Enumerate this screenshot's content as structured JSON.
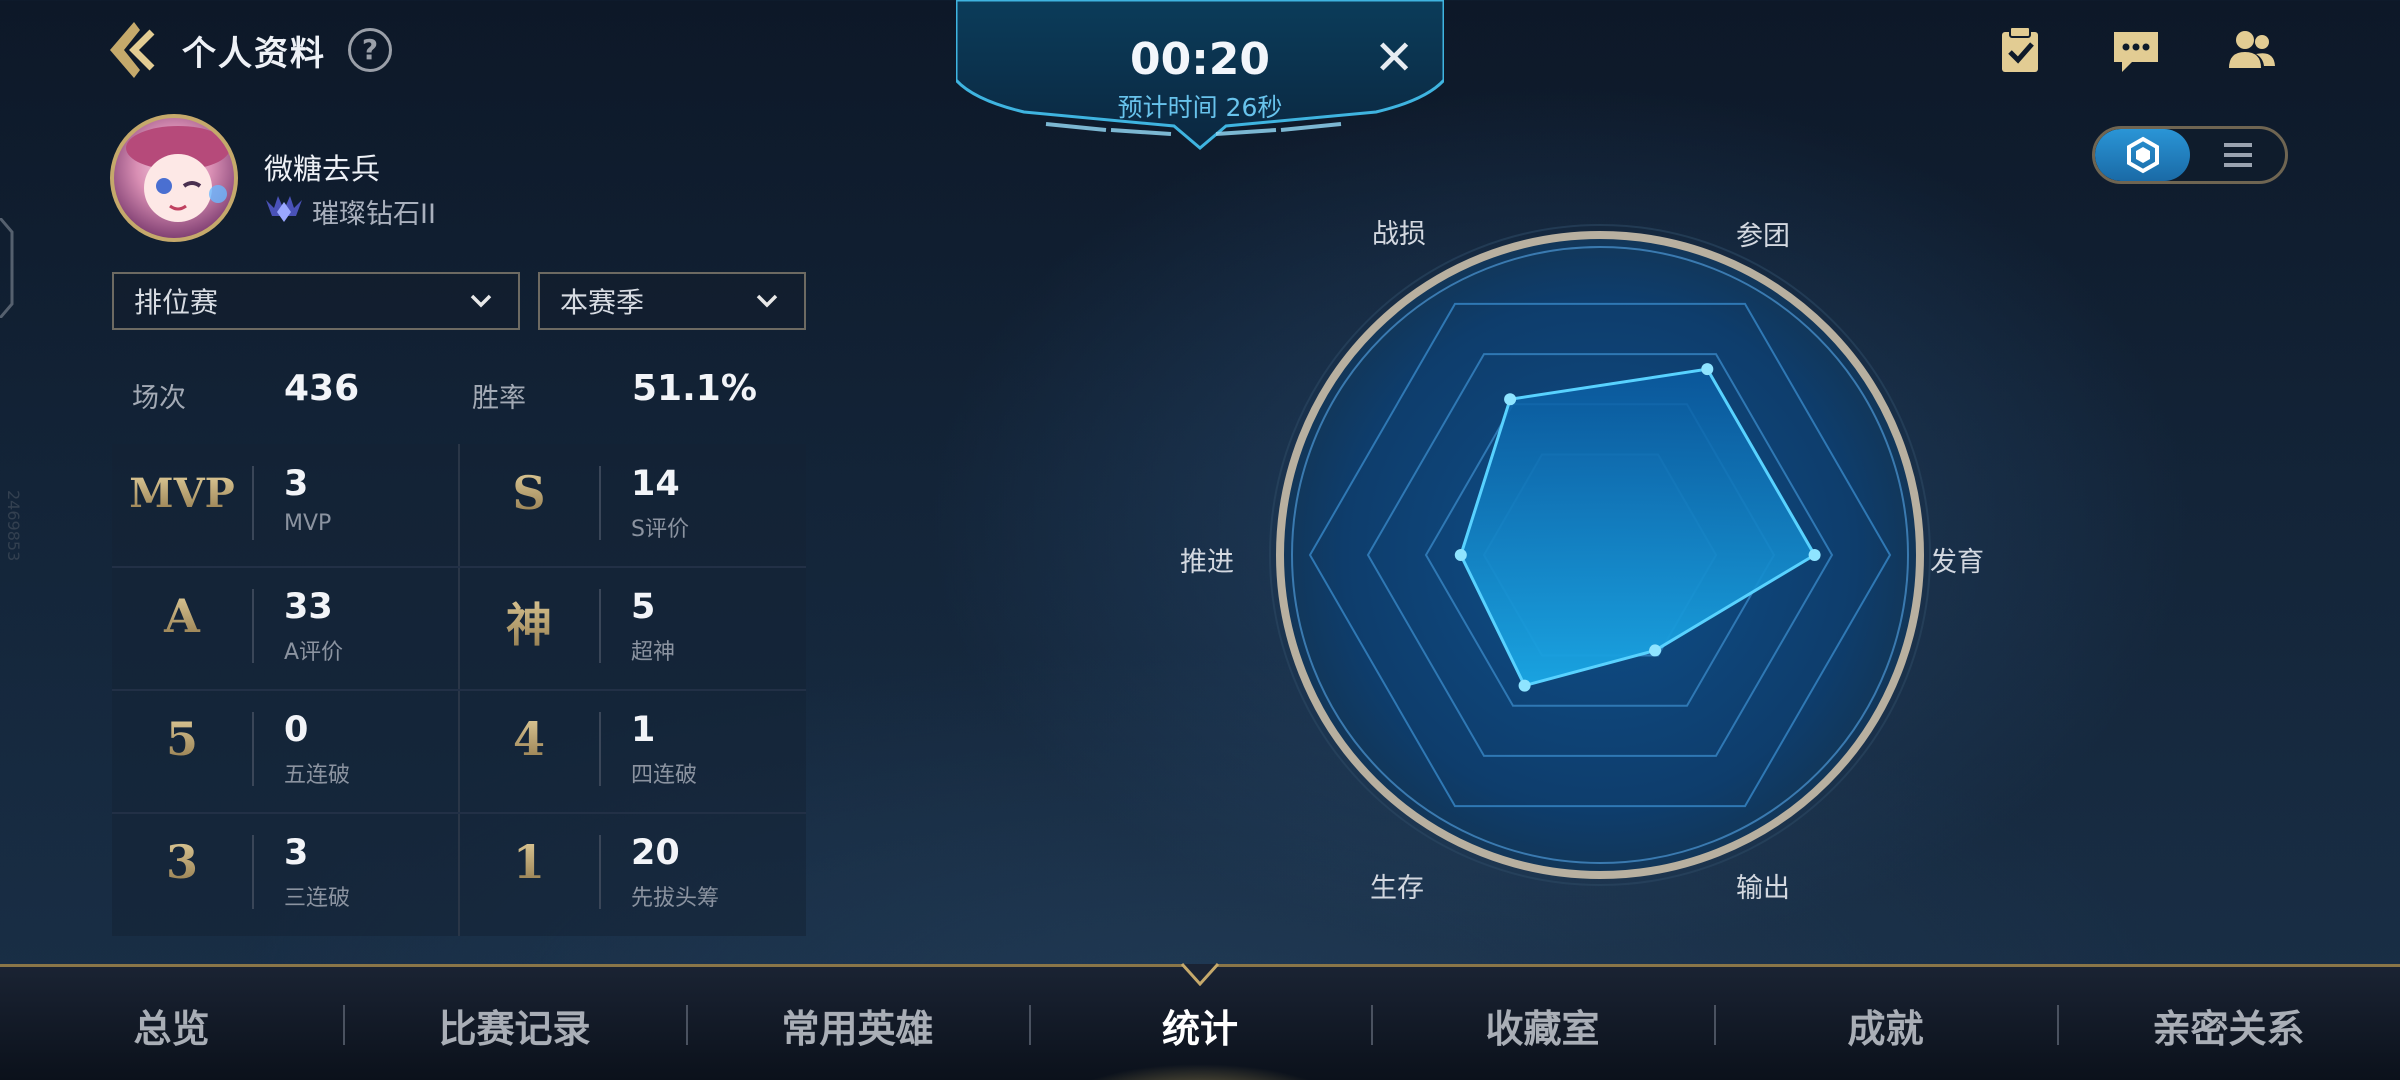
{
  "header": {
    "title": "个人资料",
    "help": "?"
  },
  "timer": {
    "time": "00:20",
    "estimate": "预计时间 26秒",
    "close": "✕"
  },
  "top_icons": [
    "task-icon",
    "chat-icon",
    "friends-icon"
  ],
  "view_toggle": {
    "active": "radar"
  },
  "profile": {
    "name": "微糖去兵",
    "rank": "璀璨钻石II"
  },
  "filters": {
    "mode": "排位赛",
    "season": "本赛季"
  },
  "summary": {
    "games_label": "场次",
    "games_value": "436",
    "winrate_label": "胜率",
    "winrate_value": "51.1%"
  },
  "stats": [
    {
      "glyph": "MVP",
      "value": "3",
      "label": "MVP"
    },
    {
      "glyph": "S",
      "value": "14",
      "label": "S评价"
    },
    {
      "glyph": "A",
      "value": "33",
      "label": "A评价"
    },
    {
      "glyph": "神",
      "value": "5",
      "label": "超神"
    },
    {
      "glyph": "5",
      "value": "0",
      "label": "五连破"
    },
    {
      "glyph": "4",
      "value": "1",
      "label": "四连破"
    },
    {
      "glyph": "3",
      "value": "3",
      "label": "三连破"
    },
    {
      "glyph": "1",
      "value": "20",
      "label": "先拔头筹"
    }
  ],
  "radar": {
    "axes": [
      "战损",
      "参团",
      "发育",
      "输出",
      "生存",
      "推进"
    ],
    "values": [
      0.62,
      0.74,
      0.74,
      0.38,
      0.52,
      0.48
    ]
  },
  "nav": {
    "items": [
      "总览",
      "比赛记录",
      "常用英雄",
      "统计",
      "收藏室",
      "成就",
      "亲密关系"
    ],
    "active": "统计"
  },
  "colors": {
    "accent": "#2aa7e8",
    "gold": "#c5a96b",
    "radar_fill": "#1a7fd0"
  },
  "watermark": "2469853"
}
